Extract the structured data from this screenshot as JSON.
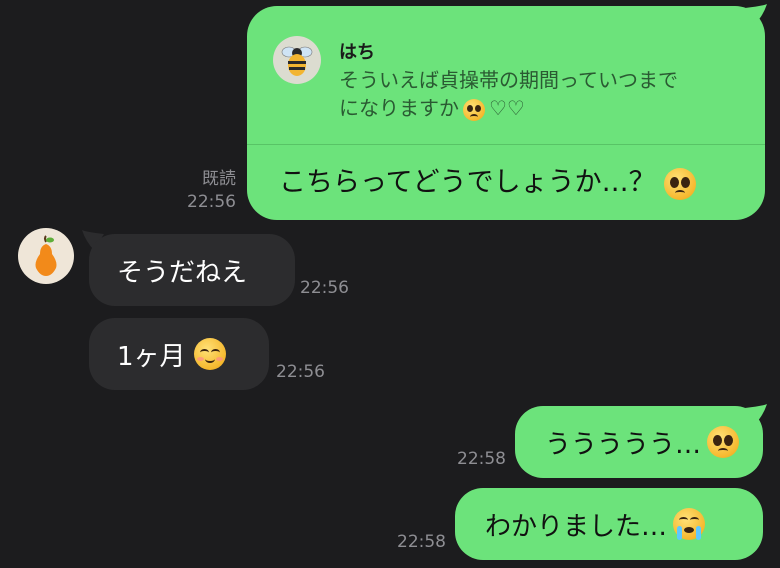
{
  "chat": {
    "reply_card": {
      "quoted_name": "はち",
      "quoted_text_line1": "そういえば貞操帯の期間っていつまで",
      "quoted_text_line2": "になりますか",
      "hearts": "♡♡",
      "message": "こちらってどうでしょうか…？"
    },
    "read_status": "既読",
    "messages": [
      {
        "side": "out",
        "time": "22:56"
      },
      {
        "side": "in",
        "text": "そうだねえ",
        "time": "22:56"
      },
      {
        "side": "in",
        "text": "1ヶ月",
        "time": "22:56"
      },
      {
        "side": "out",
        "text": "ううううう…",
        "time": "22:58"
      },
      {
        "side": "out",
        "text": "わかりました…",
        "time": "22:58"
      }
    ]
  },
  "icons": {
    "partner_avatar": "pear-avatar",
    "quoted_avatar": "bee-avatar",
    "emoji_pleading": "pleading-face",
    "emoji_smile": "smiling-face",
    "emoji_crying": "loudly-crying-face"
  },
  "colors": {
    "background": "#1c1c1e",
    "outgoing_bubble": "#6ce37b",
    "incoming_bubble": "#2c2c2e",
    "timestamp": "#8e8e93"
  }
}
